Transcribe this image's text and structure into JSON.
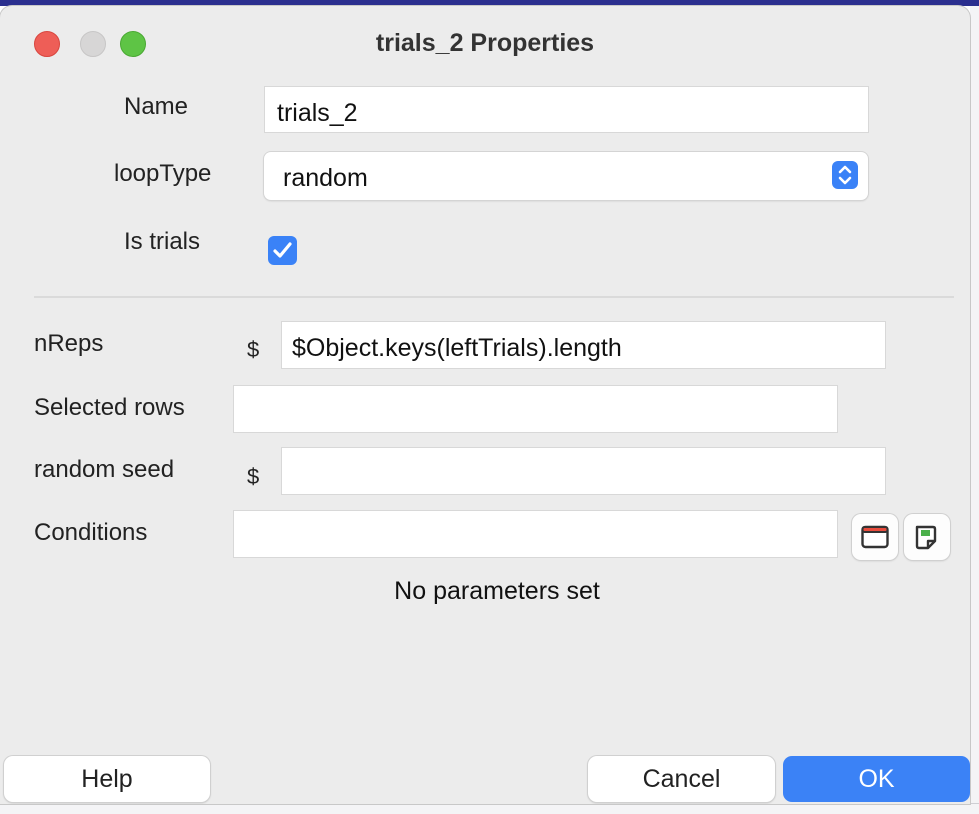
{
  "window": {
    "title": "trials_2 Properties"
  },
  "form": {
    "name": {
      "label": "Name",
      "value": "trials_2"
    },
    "loop_type": {
      "label": "loopType",
      "selected": "random"
    },
    "is_trials": {
      "label": "Is trials",
      "checked": true
    },
    "n_reps": {
      "label": "nReps",
      "prefix": "$",
      "value": "$Object.keys(leftTrials).length"
    },
    "selected_rows": {
      "label": "Selected rows",
      "value": ""
    },
    "random_seed": {
      "label": "random seed",
      "prefix": "$",
      "value": ""
    },
    "conditions": {
      "label": "Conditions",
      "value": ""
    }
  },
  "icons": {
    "open_file": "folder-icon",
    "preview": "document-icon"
  },
  "status": {
    "message": "No parameters set"
  },
  "buttons": {
    "help": "Help",
    "cancel": "Cancel",
    "ok": "OK"
  },
  "colors": {
    "accent": "#3b82f6",
    "close": "#ee5e57",
    "minimize": "#d7d6d6",
    "maximize": "#5ec445",
    "background": "#ececec"
  }
}
